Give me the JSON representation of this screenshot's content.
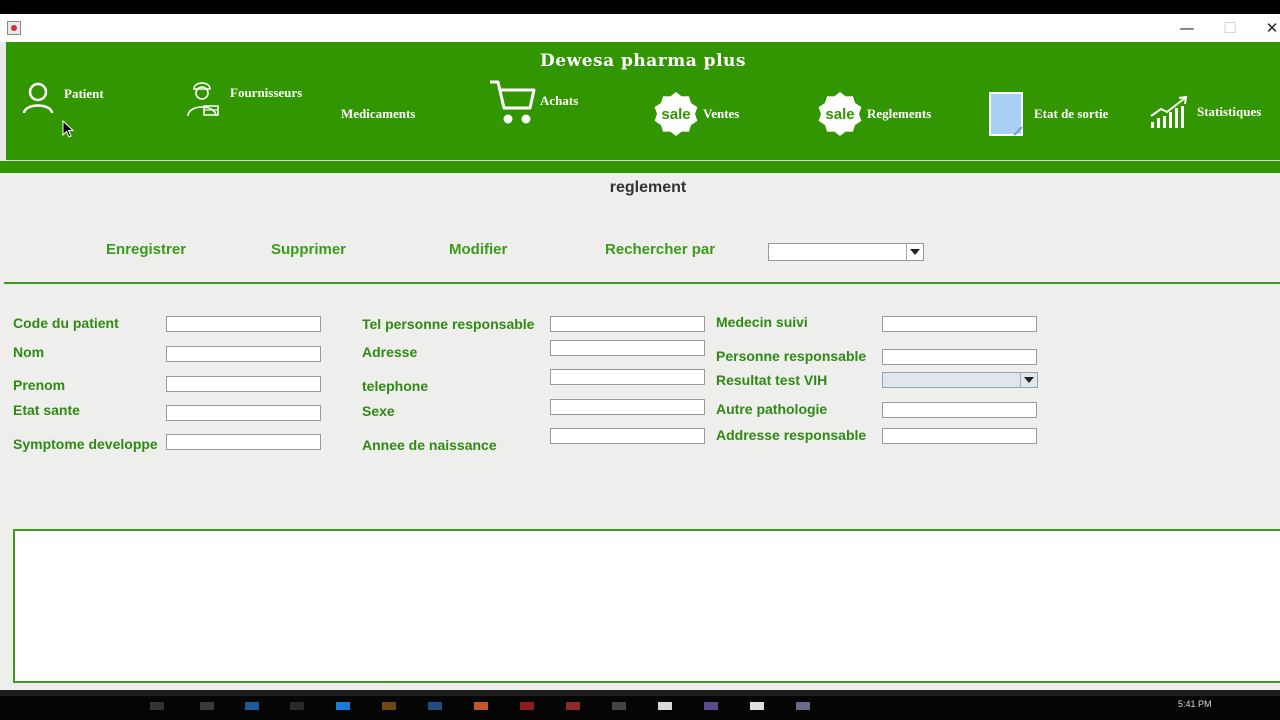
{
  "app": {
    "title": "Dewesa pharma plus",
    "window_controls": {
      "minimize": "—",
      "maximize": "☐",
      "close": "✕"
    }
  },
  "nav": [
    {
      "label": "Patient",
      "icon": "user-icon"
    },
    {
      "label": "Fournisseurs",
      "icon": "delivery-man-icon"
    },
    {
      "label": "Medicaments",
      "icon": ""
    },
    {
      "label": "Achats",
      "icon": "shopping-cart-icon"
    },
    {
      "label": "Ventes",
      "icon": "sale-badge-icon",
      "badge_text": "sale"
    },
    {
      "label": "Reglements",
      "icon": "sale-badge-icon",
      "badge_text": "sale"
    },
    {
      "label": "Etat de sortie",
      "icon": "document-icon"
    },
    {
      "label": "Statistiques",
      "icon": "chart-up-icon"
    }
  ],
  "page": {
    "title": "reglement"
  },
  "actions": {
    "save": "Enregistrer",
    "delete": "Supprimer",
    "edit": "Modifier",
    "search_by": "Rechercher par",
    "search_by_value": ""
  },
  "form": {
    "col1": [
      {
        "label": "Code du patient",
        "value": ""
      },
      {
        "label": "Nom",
        "value": ""
      },
      {
        "label": "Prenom",
        "value": ""
      },
      {
        "label": "Etat sante",
        "value": ""
      },
      {
        "label": "Symptome developpe",
        "value": ""
      }
    ],
    "col2": [
      {
        "label": "Tel personne responsable",
        "value": ""
      },
      {
        "label": "Adresse",
        "value": ""
      },
      {
        "label": "telephone",
        "value": ""
      },
      {
        "label": "Sexe",
        "value": ""
      },
      {
        "label": "Annee de naissance",
        "value": ""
      }
    ],
    "col3": [
      {
        "label": "Medecin suivi",
        "value": ""
      },
      {
        "label": "Personne responsable",
        "value": ""
      },
      {
        "label": "Resultat test VIH",
        "value": ""
      },
      {
        "label": "Autre pathologie",
        "value": ""
      },
      {
        "label": "Addresse responsable",
        "value": ""
      }
    ]
  },
  "taskbar": {
    "clock": "5:41 PM"
  },
  "colors": {
    "brand_green": "#329600",
    "label_green": "#2f8a14",
    "background": "#eeeeec"
  }
}
